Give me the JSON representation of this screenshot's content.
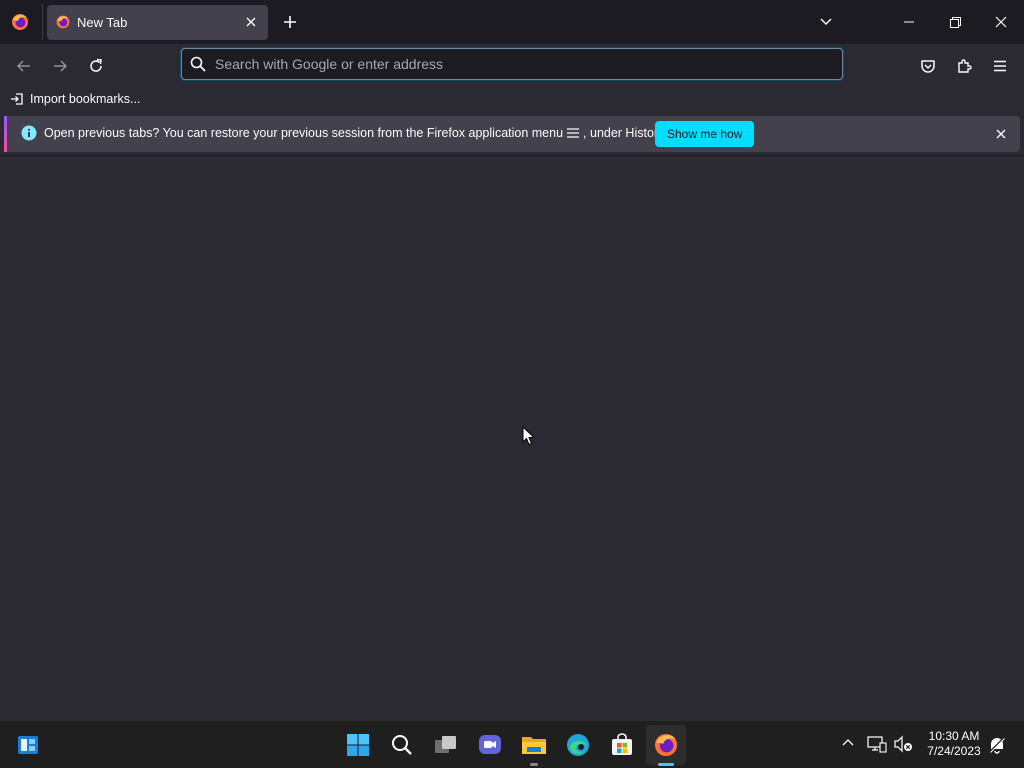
{
  "tabstrip": {
    "tab_title": "New Tab"
  },
  "navbar": {
    "url_placeholder": "Search with Google or enter address"
  },
  "bookmarks": {
    "import_label": "Import bookmarks..."
  },
  "notification": {
    "text_before_icon": "Open previous tabs? You can restore your previous session from the Firefox application menu",
    "text_after_icon": ", under History.",
    "action_label": "Show me how"
  },
  "taskbar": {
    "time": "10:30 AM",
    "date": "7/24/2023",
    "items": [
      {
        "name": "widgets",
        "icon": "widgets-icon"
      },
      {
        "name": "start",
        "icon": "windows-start-icon"
      },
      {
        "name": "search",
        "icon": "search-icon"
      },
      {
        "name": "task-view",
        "icon": "task-view-icon"
      },
      {
        "name": "teams-chat",
        "icon": "chat-icon"
      },
      {
        "name": "file-explorer",
        "icon": "folder-icon"
      },
      {
        "name": "edge",
        "icon": "edge-icon"
      },
      {
        "name": "store",
        "icon": "store-icon"
      },
      {
        "name": "firefox",
        "icon": "firefox-icon"
      }
    ]
  },
  "colors": {
    "chrome_bg": "#1c1b22",
    "toolbar_bg": "#2b2a33",
    "tab_bg": "#42414d",
    "accent": "#00ddff",
    "text": "#fbfbfe"
  }
}
